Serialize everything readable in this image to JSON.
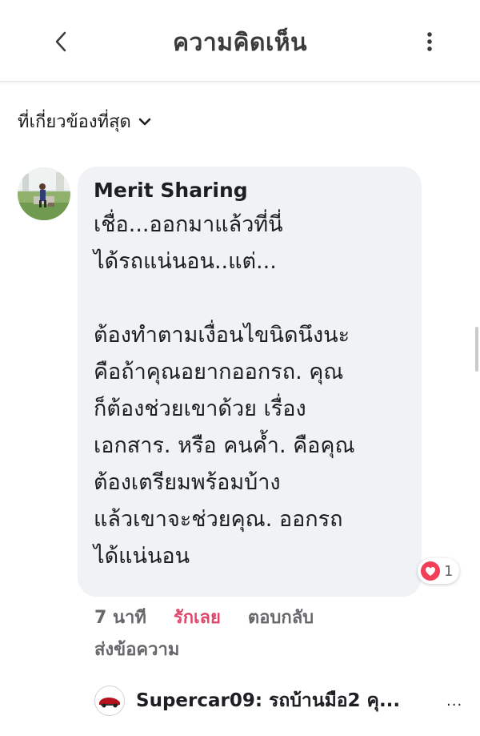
{
  "header": {
    "title": "ความคิดเห็น",
    "back_icon": "chevron-left-icon",
    "more_icon": "vertical-dots-icon"
  },
  "sort": {
    "label": "ที่เกี่ยวข้องที่สุด",
    "icon": "chevron-down-icon"
  },
  "comment": {
    "author": "Merit Sharing",
    "lines": [
      "เชื่อ...ออกมาแล้วที่นี่",
      "ได้รถแน่นอน..แต่...",
      "",
      "ต้องทำตามเงื่อนไขนิดนึงนะ",
      "คือถ้าคุณอยากออกรถ. คุณ",
      "ก็ต้องช่วยเขาด้วย เรื่อง",
      "เอกสาร. หรือ คนค้ำ. คือคุณ",
      "ต้องเตรียมพร้อมบ้าง",
      "แล้วเขาจะช่วยคุณ. ออกรถ",
      "ได้แน่นอน"
    ],
    "reaction_count": "1",
    "reaction_icon": "heart-icon",
    "reaction_color": "#f33e58",
    "actions": {
      "time": "7 นาที",
      "love": "รักเลย",
      "reply": "ตอบกลับ",
      "message": "ส่งข้อความ"
    }
  },
  "next_reply": {
    "text": "Supercar09: รถบ้านมือ2 คุ...",
    "more": "..."
  },
  "colors": {
    "bubble": "#f0f2f5",
    "love_accent": "#e0476a",
    "secondary_text": "#65676b"
  }
}
